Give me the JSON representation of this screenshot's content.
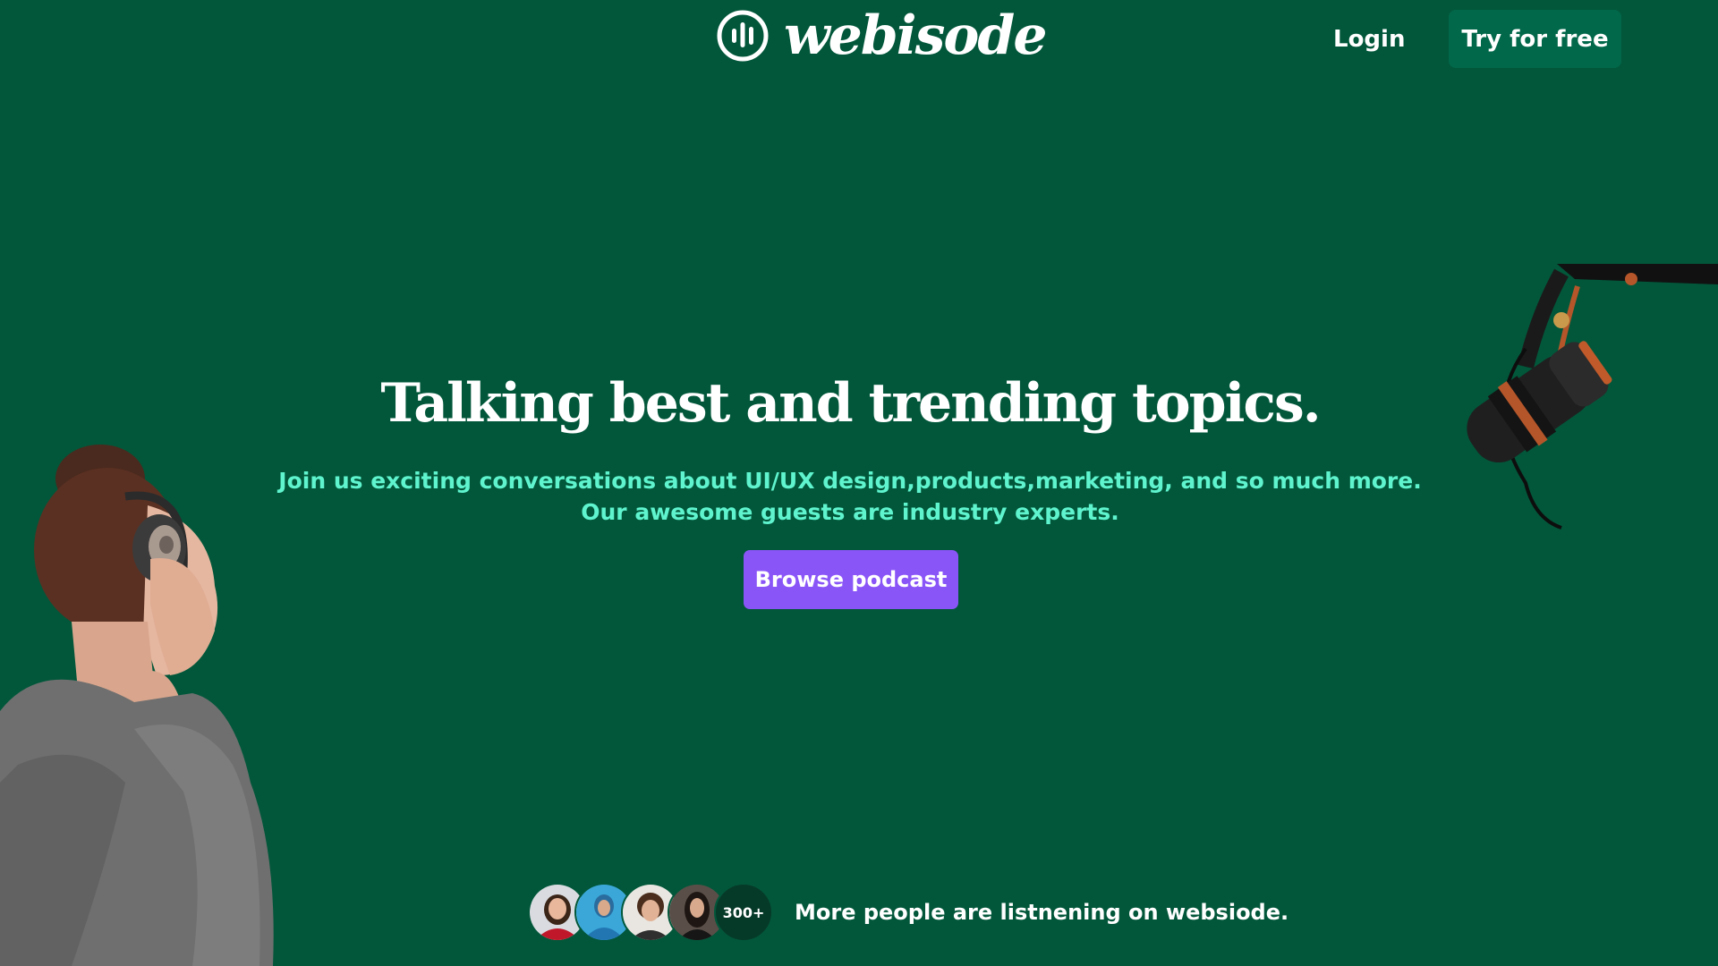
{
  "header": {
    "brand": "webisode",
    "login_label": "Login",
    "try_label": "Try for free"
  },
  "hero": {
    "title": "Talking best and trending topics.",
    "subtitle_line1": "Join us exciting conversations about UI/UX design,products,marketing, and so much more.",
    "subtitle_line2": "Our awesome guests are industry experts.",
    "browse_label": "Browse podcast"
  },
  "listeners": {
    "count_badge": "300+",
    "text": "More people are listnening on websiode."
  },
  "icons": {
    "logo": "audio-bars-circle-icon"
  },
  "colors": {
    "background": "#02573A",
    "try_button": "#02684A",
    "browse_button": "#8A55F7",
    "subtitle": "#5FF4CE",
    "text": "#FFFFFF"
  }
}
